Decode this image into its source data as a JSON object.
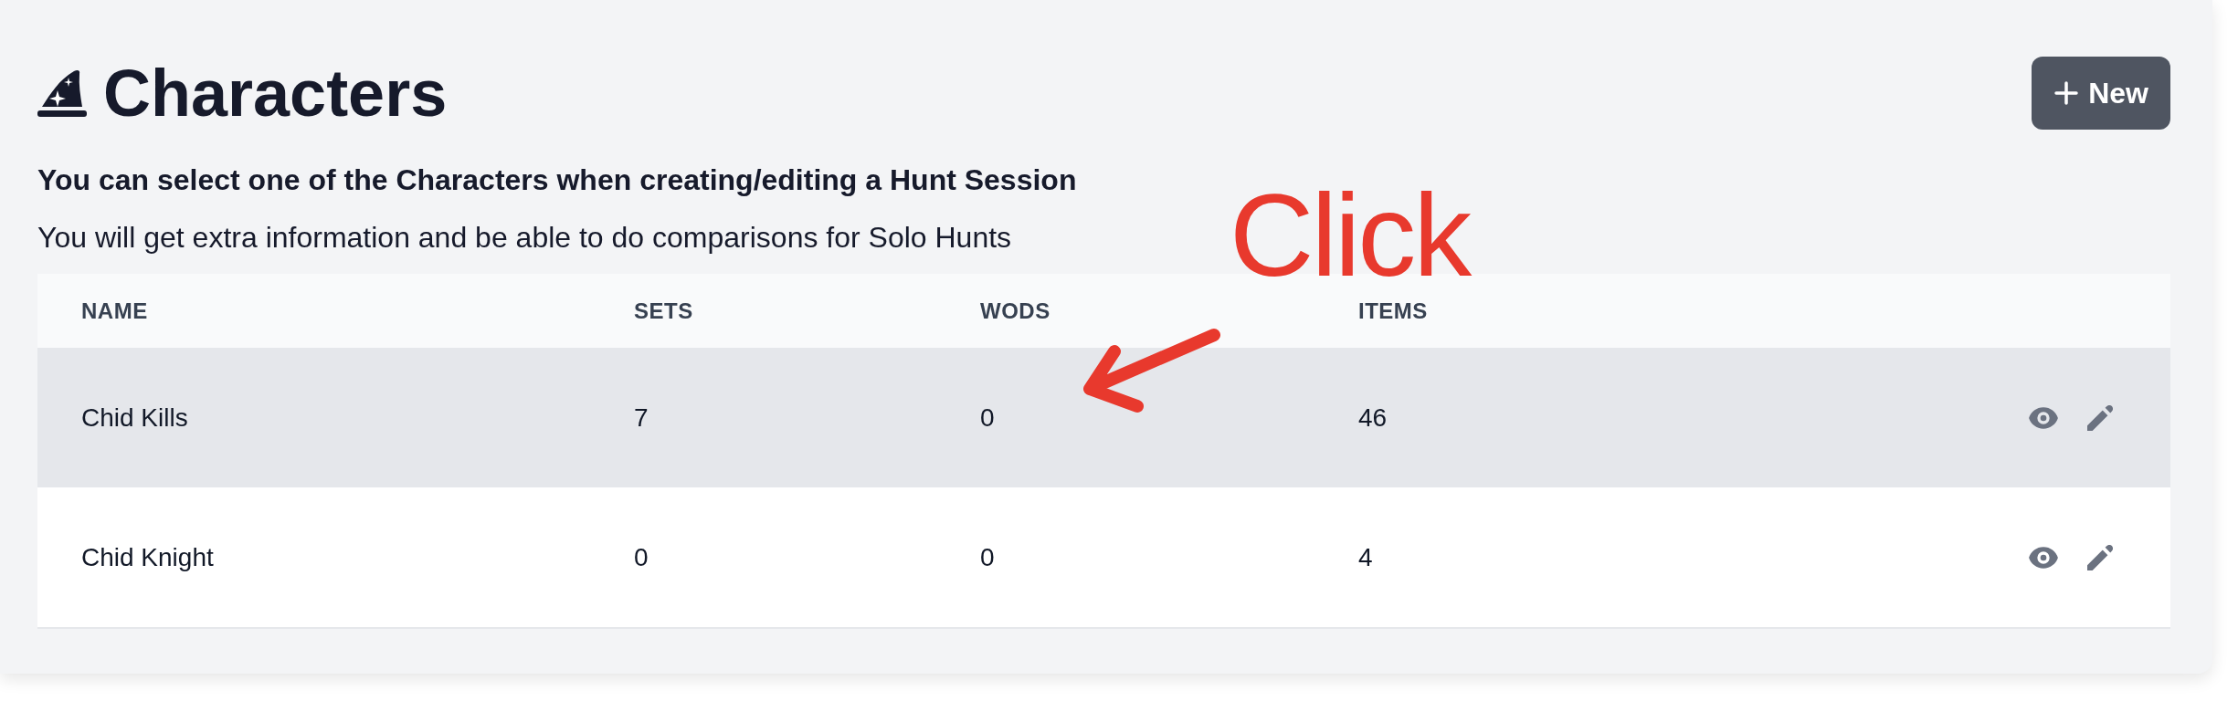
{
  "header": {
    "title": "Characters",
    "new_button": {
      "label": "New"
    }
  },
  "intro": {
    "heading": "You can select one of the Characters when creating/editing a Hunt Session",
    "text": "You will get extra information and be able to do comparisons for Solo Hunts"
  },
  "table": {
    "columns": [
      "NAME",
      "SETS",
      "WODS",
      "ITEMS"
    ],
    "rows": [
      {
        "cells": [
          "Chid Kills",
          "7",
          "0",
          "46"
        ],
        "highlighted": true
      },
      {
        "cells": [
          "Chid Knight",
          "0",
          "0",
          "4"
        ],
        "highlighted": false
      }
    ]
  },
  "annotation": {
    "text": "Click"
  }
}
